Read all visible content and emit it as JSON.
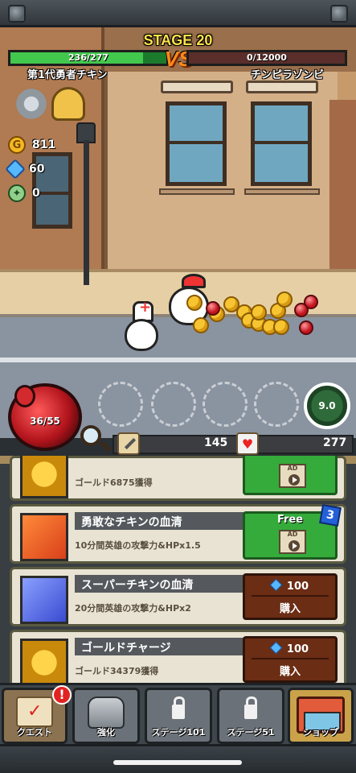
{
  "hud": {
    "stage": "STAGE 20",
    "player_hp": "236/277",
    "player_hp_fraction": 0.852,
    "vs": "VS",
    "enemy_hp": "0/12000",
    "enemy_hp_fraction": 0,
    "player_name": "第1代勇者チキン",
    "enemy_name": "チンピラゾンビ"
  },
  "resources": {
    "gold": "811",
    "gems": "60",
    "medals": "0"
  },
  "potion": {
    "value": "36/55"
  },
  "timer": {
    "value": "9.0"
  },
  "stats": {
    "attack": "145",
    "hp": "277"
  },
  "shop_items": [
    {
      "title": "",
      "desc": "ゴールド6875獲得",
      "button": "ad"
    },
    {
      "title": "勇敢なチキンの血清",
      "desc": "10分間英雄の攻撃力&HPx1.5",
      "button": "free",
      "free_label": "Free",
      "badge": "3"
    },
    {
      "title": "スーパーチキンの血清",
      "desc": "20分間英雄の攻撃力&HPx2",
      "button": "buy",
      "price": "100",
      "buy_label": "購入"
    },
    {
      "title": "ゴールドチャージ",
      "desc": "ゴールド34379獲得",
      "button": "buy",
      "price": "100",
      "buy_label": "購入"
    }
  ],
  "ad_label": "AD",
  "nav": [
    {
      "label": "クエスト",
      "icon": "quest-scroll-icon",
      "alert": "!"
    },
    {
      "label": "強化",
      "icon": "armor-icon"
    },
    {
      "label": "ステージ101",
      "icon": "lock-icon"
    },
    {
      "label": "ステージ51",
      "icon": "lock-icon"
    },
    {
      "label": "ショップ",
      "icon": "shop-icon"
    }
  ],
  "colors": {
    "hp_green": "#43c84e",
    "stage_yellow": "#ffe24a",
    "buy_brown": "#6b2d14",
    "ad_green": "#35ab3b"
  }
}
